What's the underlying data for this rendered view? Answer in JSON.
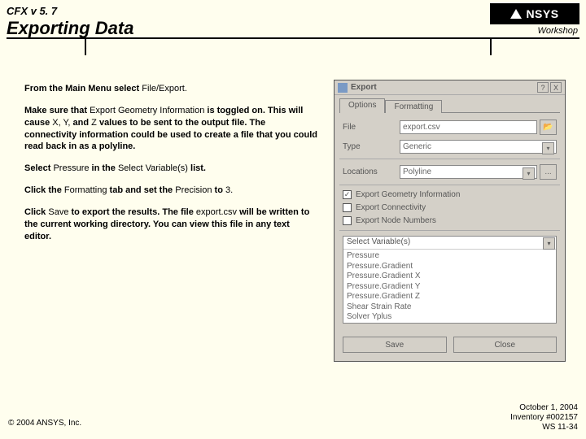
{
  "header": {
    "version": "CFX v 5. 7",
    "title": "Exporting Data",
    "workshop": "Workshop",
    "logo": "NSYS"
  },
  "instructions": {
    "p1a": "From the Main Menu select ",
    "p1b": "File/Export.",
    "p2a": "Make sure that ",
    "p2b": "Export Geometry Information",
    "p2c": " is toggled on. This will cause ",
    "p2d": "X, Y,",
    "p2e": " and ",
    "p2f": "Z",
    "p2g": " values to be sent to the output file. The connectivity information could be used to create a file that you could read back in as a polyline.",
    "p3a": "Select ",
    "p3b": "Pressure",
    "p3c": " in the ",
    "p3d": "Select Variable(s)",
    "p3e": " list.",
    "p4a": "Click the ",
    "p4b": "Formatting",
    "p4c": " tab and set the ",
    "p4d": "Precision",
    "p4e": " to ",
    "p4f": "3.",
    "p5a": "Click ",
    "p5b": "Save",
    "p5c": " to export the results. The file ",
    "p5d": "export.csv",
    "p5e": " will be written to the current working directory. You can view this file in any text editor."
  },
  "dialog": {
    "title": "Export",
    "tabs": {
      "options": "Options",
      "formatting": "Formatting"
    },
    "labels": {
      "file": "File",
      "type": "Type",
      "locations": "Locations"
    },
    "fields": {
      "file": "export.csv",
      "type": "Generic",
      "locations": "Polyline"
    },
    "checks": {
      "geom": "Export Geometry Information",
      "conn": "Export Connectivity",
      "node": "Export Node Numbers"
    },
    "selvar": {
      "label": "Select Variable(s)",
      "items": [
        "Pressure",
        "Pressure.Gradient",
        "Pressure.Gradient X",
        "Pressure.Gradient Y",
        "Pressure.Gradient Z",
        "Shear Strain Rate",
        "Solver Yplus"
      ]
    },
    "buttons": {
      "save": "Save",
      "close": "Close",
      "dots": "...",
      "help": "?",
      "x": "X"
    }
  },
  "footer": {
    "copyright": "© 2004 ANSYS, Inc.",
    "date": "October 1, 2004",
    "inv": "Inventory #002157",
    "ws": "WS 11-34"
  }
}
